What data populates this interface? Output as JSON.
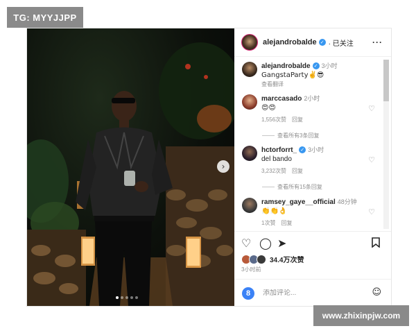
{
  "watermark_top": "TG: MYYJJPP",
  "watermark_bottom": "www.zhixinpjw.com",
  "post": {
    "carousel_next": "›",
    "author": "alejandrobalde",
    "follow_status": "· 已关注",
    "more": "···",
    "caption": {
      "user": "alejandrobalde",
      "time": "3小时",
      "text": "GangstaParty✌️😎",
      "translate": "查看翻译"
    }
  },
  "comments": [
    {
      "user": "marccasado",
      "time": "2小时",
      "text": "😍😍",
      "likes": "1,556次赞",
      "reply": "回复",
      "view_replies": "查看所有3条回复"
    },
    {
      "user": "hctorforrt_",
      "time": "3小时",
      "text": "del bando",
      "likes": "3,232次赞",
      "reply": "回复",
      "view_replies": "查看所有15条回复",
      "verified": true
    },
    {
      "user": "ramsey_gaye__official",
      "time": "48分钟",
      "text": "👏👏👌",
      "likes": "1次赞",
      "reply": "回复"
    }
  ],
  "actions": {
    "like_icon": "heart-icon",
    "comment_icon": "comment-icon",
    "share_icon": "share-icon",
    "save_icon": "bookmark-icon",
    "likes": "34.4万次赞",
    "posted": "3小时前"
  },
  "add_comment": {
    "badge": "8",
    "placeholder": "添加评论..."
  },
  "colors": {
    "verified": "#3897f0",
    "story_ring": "#d62976",
    "badge": "#3b82f6"
  }
}
